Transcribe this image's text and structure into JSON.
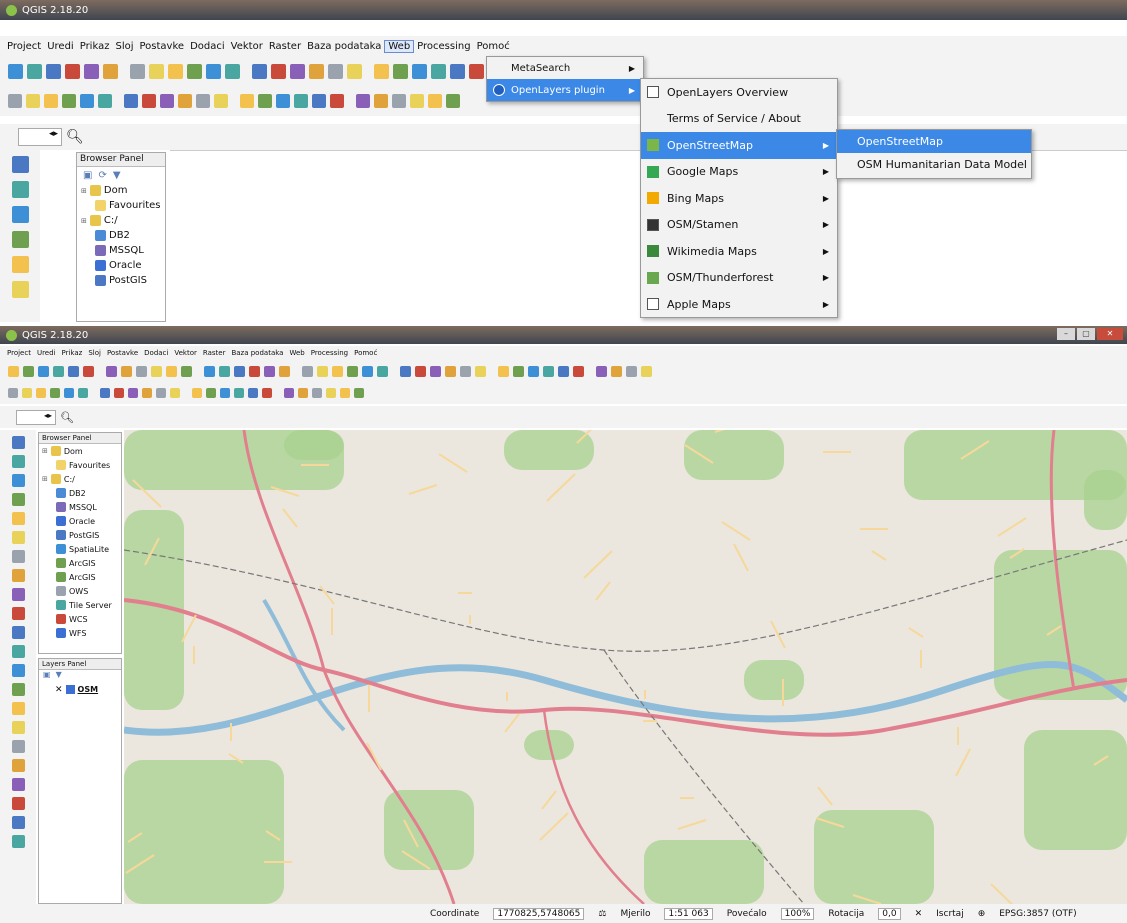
{
  "top_window": {
    "title": "QGIS 2.18.20",
    "menu": [
      "Project",
      "Uredi",
      "Prikaz",
      "Sloj",
      "Postavke",
      "Dodaci",
      "Vektor",
      "Raster",
      "Baza podataka",
      "Web",
      "Processing",
      "Pomoć"
    ],
    "active_menu": "Web",
    "zoom_input": "",
    "browser_panel": {
      "title": "Browser Panel",
      "items": [
        "Dom",
        "Favourites",
        "C:/",
        "DB2",
        "MSSQL",
        "Oracle",
        "PostGIS"
      ]
    },
    "web_menu": {
      "items": [
        {
          "label": "MetaSearch",
          "has_sub": true
        },
        {
          "label": "OpenLayers plugin",
          "has_sub": true
        }
      ]
    },
    "openlayers_menu": {
      "items": [
        {
          "label": "OpenLayers Overview",
          "has_sub": false,
          "icon": "checkbox-icon"
        },
        {
          "label": "Terms of Service / About",
          "has_sub": false,
          "icon": ""
        },
        {
          "label": "OpenStreetMap",
          "has_sub": true,
          "icon": "osm-icon"
        },
        {
          "label": "Google Maps",
          "has_sub": true,
          "icon": "google-maps-icon"
        },
        {
          "label": "Bing Maps",
          "has_sub": true,
          "icon": "bing-maps-icon"
        },
        {
          "label": "OSM/Stamen",
          "has_sub": true,
          "icon": "stamen-icon"
        },
        {
          "label": "Wikimedia Maps",
          "has_sub": true,
          "icon": "wikimedia-icon"
        },
        {
          "label": "OSM/Thunderforest",
          "has_sub": true,
          "icon": "thunderforest-icon"
        },
        {
          "label": "Apple Maps",
          "has_sub": true,
          "icon": "apple-maps-icon"
        }
      ]
    },
    "osm_submenu": {
      "items": [
        "OpenStreetMap",
        "OSM Humanitarian Data Model"
      ]
    }
  },
  "bottom_window": {
    "title": "QGIS 2.18.20",
    "menu": [
      "Project",
      "Uredi",
      "Prikaz",
      "Sloj",
      "Postavke",
      "Dodaci",
      "Vektor",
      "Raster",
      "Baza podataka",
      "Web",
      "Processing",
      "Pomoć"
    ],
    "browser_panel": {
      "title": "Browser Panel",
      "items": [
        "Dom",
        "Favourites",
        "C:/",
        "DB2",
        "MSSQL",
        "Oracle",
        "PostGIS",
        "SpatiaLite",
        "ArcGIS",
        "ArcGIS",
        "OWS",
        "Tile Server",
        "WCS",
        "WFS"
      ]
    },
    "layers_panel": {
      "title": "Layers Panel",
      "layer": "OSM"
    },
    "statusbar": {
      "coordinate_label": "Coordinate",
      "coordinate_value": "1770825,5748065",
      "scale_label": "Mjerilo",
      "scale_value": "1:51 063",
      "magnifier_label": "Povećalo",
      "magnifier_value": "100%",
      "rotation_label": "Rotacija",
      "rotation_value": "0,0",
      "render_label": "Iscrtaj",
      "crs_label": "EPSG:3857 (OTF)"
    },
    "colors": {
      "map_land": "#ebe7df",
      "map_green": "#a8d18d",
      "map_river": "#8fbcd8",
      "map_highway": "#e27f8e",
      "menu_highlight": "#3b88e6"
    }
  }
}
